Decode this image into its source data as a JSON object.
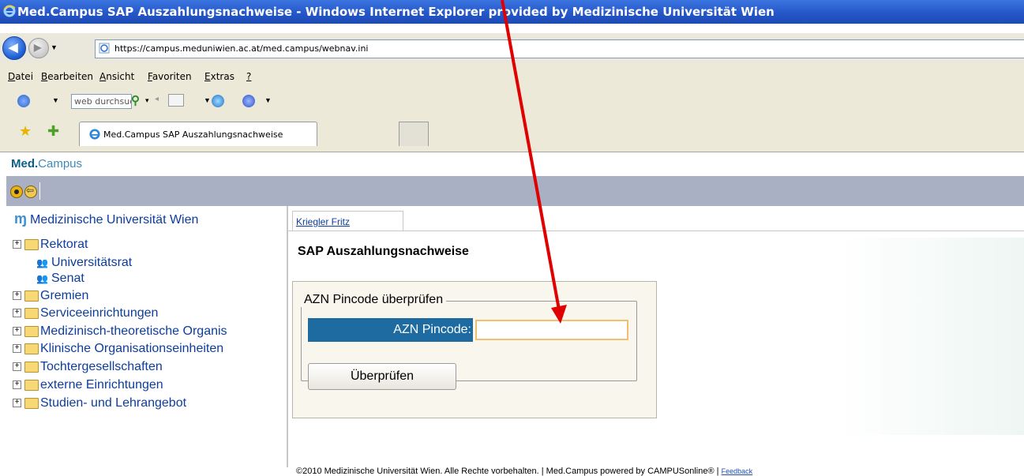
{
  "window": {
    "title": "Med.Campus SAP Auszahlungsnachweise - Windows Internet Explorer provided by Medizinische Universität Wien"
  },
  "address_bar": {
    "url": "https://campus.meduniwien.ac.at/med.campus/webnav.ini"
  },
  "menu": {
    "items": [
      {
        "first": "D",
        "rest": "atei"
      },
      {
        "first": "B",
        "rest": "earbeiten"
      },
      {
        "first": "A",
        "rest": "nsicht"
      },
      {
        "first": "F",
        "rest": "avoriten"
      },
      {
        "first": "E",
        "rest": "xtras"
      },
      {
        "first": "?",
        "rest": ""
      }
    ]
  },
  "toolbar": {
    "search_value": "web durchsuc"
  },
  "tabs": [
    {
      "label": "Med.Campus SAP Auszahlungsnachweise"
    }
  ],
  "app": {
    "logo_bold": "Med.",
    "logo_light": "Campus"
  },
  "tree": {
    "root": "Medizinische Universität Wien",
    "items": [
      {
        "label": "Rektorat",
        "type": "folder",
        "expandable": true
      },
      {
        "label": "Universitätsrat",
        "type": "people",
        "expandable": false
      },
      {
        "label": "Senat",
        "type": "people",
        "expandable": false
      },
      {
        "label": "Gremien",
        "type": "folder",
        "expandable": true
      },
      {
        "label": "Serviceeinrichtungen",
        "type": "folder",
        "expandable": true
      },
      {
        "label": "Medizinisch-theoretische Organis",
        "type": "folder",
        "expandable": true
      },
      {
        "label": "Klinische Organisationseinheiten",
        "type": "folder",
        "expandable": true
      },
      {
        "label": "Tochtergesellschaften",
        "type": "folder",
        "expandable": true
      },
      {
        "label": "externe Einrichtungen",
        "type": "folder",
        "expandable": true
      },
      {
        "label": "Studien- und Lehrangebot",
        "type": "folder",
        "expandable": true
      }
    ]
  },
  "content": {
    "user_tab": "Kriegler Fritz",
    "page_title": "SAP Auszahlungsnachweise",
    "fieldset_legend": "AZN Pincode überprüfen",
    "pin_label": "AZN Pincode:",
    "pin_value": "",
    "check_button": "Überprüfen",
    "footer_text": "©2010 Medizinische Universität Wien. Alle Rechte vorbehalten. | Med.Campus powered by CAMPUSonline® | ",
    "footer_link": "Feedback"
  },
  "colors": {
    "annotation_arrow": "#e00000",
    "titlebar": "#2557c9",
    "label_bg": "#1d6ba1"
  }
}
